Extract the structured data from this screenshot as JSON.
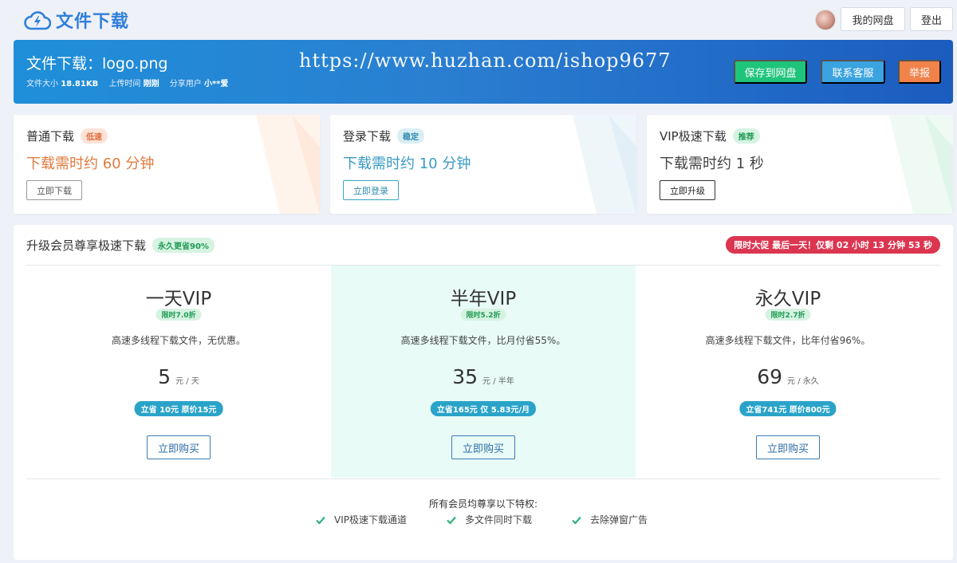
{
  "header": {
    "app_title": "文件下载",
    "my_pan_label": "我的网盘",
    "logout_label": "登出"
  },
  "hero": {
    "title": "文件下载：logo.png",
    "size_label": "文件大小",
    "size_value": "18.81KB",
    "upload_label": "上传时间",
    "upload_value": "刚刚",
    "share_label": "分享用户",
    "share_value": "小**爱",
    "watermark_url": "https://www.huzhan.com/ishop9677",
    "save_label": "保存到网盘",
    "service_label": "联系客服",
    "report_label": "举报"
  },
  "options": [
    {
      "title": "普通下载",
      "tag": "低速",
      "time": "下载需时约 60 分钟",
      "button": "立即下载"
    },
    {
      "title": "登录下载",
      "tag": "稳定",
      "time": "下载需时约 10 分钟",
      "button": "立即登录"
    },
    {
      "title": "VIP极速下载",
      "tag": "推荐",
      "time": "下载需时约 1 秒",
      "button": "立即升级"
    }
  ],
  "upgrade": {
    "title": "升级会员尊享极速下载",
    "tag": "永久更省90%",
    "promo": "限时大促 最后一天！仅剩 02 小时 13 分钟 53 秒",
    "plans": [
      {
        "name": "一天VIP",
        "discount": "限时7.0折",
        "desc": "高速多线程下载文件，无优惠。",
        "price": "5",
        "unit": "元 / 天",
        "save": "立省 10元 原价15元",
        "buy": "立即购买"
      },
      {
        "name": "半年VIP",
        "discount": "限时5.2折",
        "desc": "高速多线程下载文件，比月付省55%。",
        "price": "35",
        "unit": "元 / 半年",
        "save": "立省165元 仅 5.83元/月",
        "buy": "立即购买"
      },
      {
        "name": "永久VIP",
        "discount": "限时2.7折",
        "desc": "高速多线程下载文件，比年付省96%。",
        "price": "69",
        "unit": "元 / 永久",
        "save": "立省741元 原价800元",
        "buy": "立即购买"
      }
    ],
    "perks_title": "所有会员均尊享以下特权:",
    "perks": [
      "VIP极速下载通道",
      "多文件同时下载",
      "去除弹窗广告"
    ]
  },
  "icons": {
    "logo": "cloud-lightning-icon",
    "perk": "check-icon"
  },
  "colors": {
    "brand": "#2f7fdc",
    "save_button": "#1fc47b",
    "service_button": "#3aa3e0",
    "report_button": "#f0824a",
    "promo": "#dc3550",
    "slow_time": "#e07b3e",
    "login_time": "#3a9bc4"
  }
}
